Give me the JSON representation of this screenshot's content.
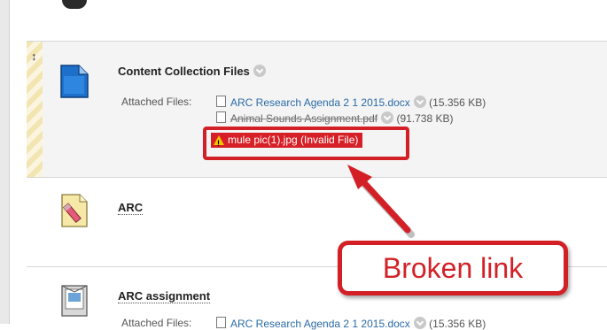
{
  "items": [
    {
      "title": "Content Collection Files",
      "attached_label": "Attached Files:",
      "files": [
        {
          "name": "ARC Research Agenda 2 1 2015.docx",
          "size": "(15.356 KB)"
        },
        {
          "name": "Animal Sounds Assignment.pdf",
          "size": "(91.738 KB)"
        }
      ],
      "invalid_file": "mule pic(1).jpg (Invalid File)"
    },
    {
      "title": "ARC"
    },
    {
      "title": "ARC assignment",
      "attached_label": "Attached Files:",
      "files": [
        {
          "name": "ARC Research Agenda 2 1 2015.docx",
          "size": "(15.356 KB)"
        }
      ]
    }
  ],
  "annotation": {
    "label": "Broken link",
    "color": "#d32027"
  },
  "icons": {
    "item1": "document-icon",
    "item2": "edit-document-icon",
    "item3": "assignment-icon",
    "drag": "drag-handle-icon",
    "options": "chevron-down-icon",
    "warning": "warning-icon"
  }
}
